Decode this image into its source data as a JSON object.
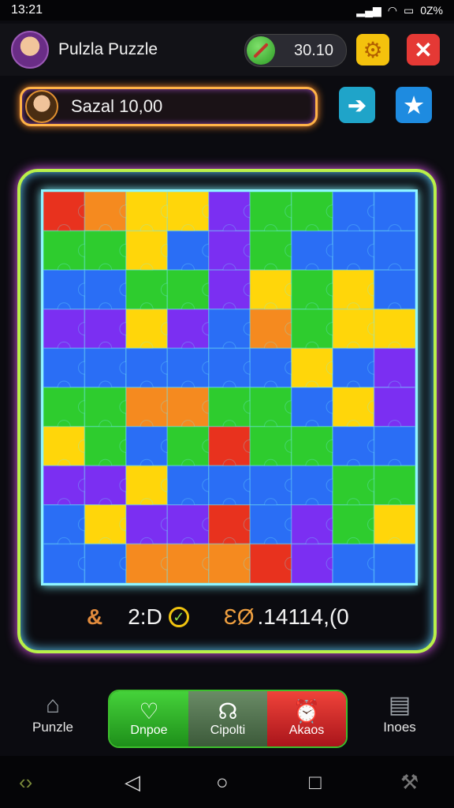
{
  "status_bar": {
    "time": "13:21",
    "battery": "0Z%"
  },
  "header": {
    "title": "Pulzla Puzzle",
    "score": "30.10"
  },
  "player": {
    "name": "Sazal 10,00"
  },
  "stats": {
    "icon_label": "&",
    "time": "2:D",
    "moves": "ƐØ",
    "total": ".14114,(0"
  },
  "bottom_nav": {
    "left": {
      "label": "Punzle",
      "icon": "home-icon"
    },
    "right": {
      "label": "Inoes",
      "icon": "toolbox-icon"
    },
    "actions": [
      {
        "label": "Dnpoe",
        "icon": "shield-icon",
        "color": "#3fcf34"
      },
      {
        "label": "Cipolti",
        "icon": "headset-icon",
        "color": "#5b7d58"
      },
      {
        "label": "Akaos",
        "icon": "alarm-icon",
        "color": "#e2262b"
      }
    ]
  },
  "puzzle": {
    "rows": 10,
    "cols": 9,
    "palette": {
      "R": "#e8321e",
      "O": "#f58a1f",
      "Y": "#ffd60a",
      "G": "#2ecc2e",
      "B": "#2a6ef5",
      "P": "#7b2ff2"
    },
    "grid": [
      "ROYYPGGBB",
      "GGYBPGBBB",
      "BBGGPYGYB",
      "PPYPBOGYY",
      "BBBBBBYBP",
      "GGOOGGBYP",
      "YGBGRGGBB",
      "PPYBBBBGG",
      "BYPPRBPGY",
      "BBOOORPBB"
    ]
  }
}
